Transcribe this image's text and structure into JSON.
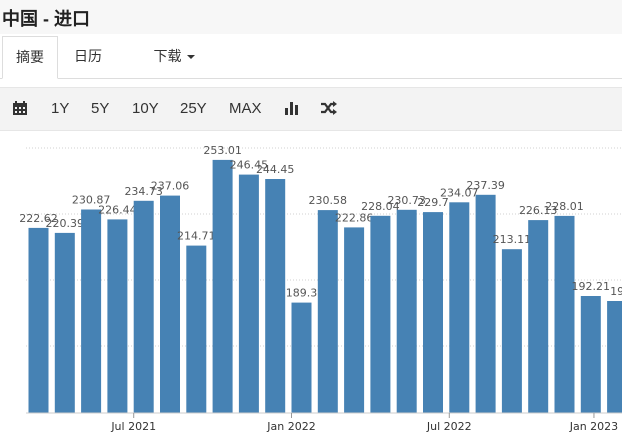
{
  "header": {
    "title": "中国 - 进口"
  },
  "tabs": [
    {
      "label": "摘要",
      "active": true
    },
    {
      "label": "日历",
      "active": false
    },
    {
      "label": "下载",
      "active": false
    }
  ],
  "toolbar": {
    "calendar_icon": "calendar-icon",
    "ranges": [
      "1Y",
      "5Y",
      "10Y",
      "25Y",
      "MAX"
    ],
    "chart_icon": "bar-chart-icon",
    "shuffle_icon": "shuffle-icon"
  },
  "colors": {
    "bar": "#4682b4",
    "toolbar_bg": "#f3f3f3"
  },
  "chart_data": {
    "type": "bar",
    "ylim": [
      140,
      265
    ],
    "grid": true,
    "categories": [
      "2021-03",
      "2021-04",
      "2021-05",
      "2021-06",
      "2021-07",
      "2021-08",
      "2021-09",
      "2021-10",
      "2021-11",
      "2021-12",
      "2022-01",
      "2022-02",
      "2022-03",
      "2022-04",
      "2022-05",
      "2022-06",
      "2022-07",
      "2022-08",
      "2022-09",
      "2022-10",
      "2022-11",
      "2022-12",
      "2023-01",
      "2023-02"
    ],
    "values": [
      222.62,
      220.39,
      230.87,
      226.44,
      234.73,
      237.06,
      214.71,
      253.01,
      246.45,
      244.45,
      189.3,
      230.58,
      222.86,
      228.04,
      230.73,
      229.7,
      234.07,
      237.39,
      213.11,
      226.13,
      228.01,
      192.21,
      190,
      null
    ],
    "data_labels": [
      "222.62",
      "220.39",
      "230.87",
      "226.44",
      "234.73",
      "237.06",
      "214.71",
      "253.01",
      "246.45",
      "244.45",
      "189.3",
      "230.58",
      "222.86",
      "228.04",
      "230.73",
      "229.7",
      "234.07",
      "237.39",
      "213.11",
      "226.13",
      "228.01",
      "192.21",
      "19",
      ""
    ],
    "x_ticks": [
      {
        "label": "Jul 2021",
        "index": 4
      },
      {
        "label": "Jan 2022",
        "index": 10
      },
      {
        "label": "Jul 2022",
        "index": 16
      },
      {
        "label": "Jan 2023",
        "index": 21.5
      }
    ]
  }
}
